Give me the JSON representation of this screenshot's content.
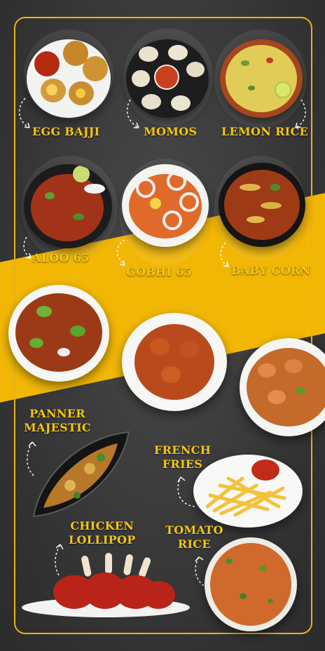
{
  "menu": {
    "items": [
      {
        "id": "egg-bajji",
        "label": "EGG BAJJI"
      },
      {
        "id": "momos",
        "label": "MOMOS"
      },
      {
        "id": "lemon-rice",
        "label": "LEMON RICE"
      },
      {
        "id": "aloo-65",
        "label": "ALOO 65"
      },
      {
        "id": "gobhi-65",
        "label": "GOBHI 65"
      },
      {
        "id": "baby-corn",
        "label": "BABY CORN"
      },
      {
        "id": "panner-majestic",
        "label_line1": "PANNER",
        "label_line2": "MAJESTIC"
      },
      {
        "id": "french-fries",
        "label_line1": "FRENCH",
        "label_line2": "FRIES"
      },
      {
        "id": "chicken-lollipop",
        "label_line1": "CHICKEN",
        "label_line2": "LOLLIPOP"
      },
      {
        "id": "tomato-rice",
        "label_line1": "TOMATO",
        "label_line2": "RICE"
      }
    ]
  },
  "colors": {
    "accent": "#f4c51a",
    "band": "#f2b705",
    "background": "#3a3a3a"
  }
}
